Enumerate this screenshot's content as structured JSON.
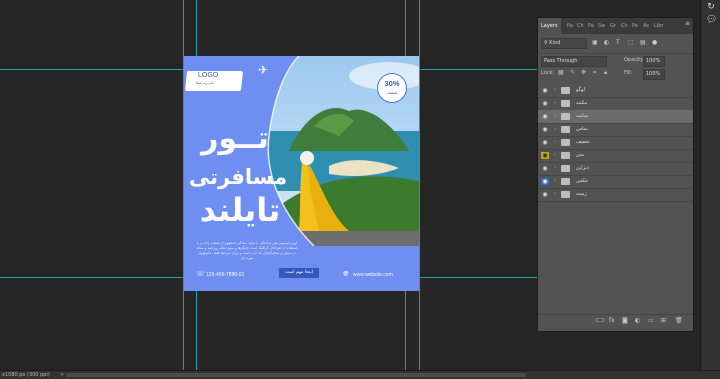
{
  "status": {
    "zoom": "x1080 px (300 ppi)",
    "arrow": ">"
  },
  "right_toolbar": {
    "icons": [
      "history-icon",
      "comments-icon"
    ]
  },
  "poster": {
    "logo": "LOGO",
    "logo_sub": "نام برند شما",
    "badge_percent": "30%",
    "badge_label": "تخفیف",
    "headline_1": "تــور",
    "headline_2": "مسافرتی",
    "headline_3": "تایلند",
    "paragraph": "لورم ایپسوم متن ساختگی با تولید سادگی نامفهوم از صنعت چاپ و با استفاده از طراحان گرافیک است چاپگرها و متون بلکه روزنامه و مجله در ستون و سطرآنچنان که لازم است و برای شرایط فعلی تکنولوژی مورد نیاز",
    "phone": "123-456-7890-01",
    "cta": "اینجا مهم است",
    "website": "www.website.com"
  },
  "layers_panel": {
    "tabs": [
      "Layers",
      "Pa",
      "Ch",
      "Pa",
      "Sw",
      "Gr",
      "Ch",
      "Pa",
      "Ac",
      "Libr"
    ],
    "active_tab": "Layers",
    "kind_label": "Kind",
    "blend_mode": "Pass Through",
    "opacity_label": "Opacity:",
    "opacity_value": "100%",
    "lock_label": "Lock:",
    "fill_label": "Fill:",
    "fill_value": "100%",
    "layers": [
      {
        "name": "لوگو",
        "visible": true,
        "selected": false,
        "eye_color": ""
      },
      {
        "name": "مکمه",
        "visible": true,
        "selected": false,
        "eye_color": ""
      },
      {
        "name": "سایت",
        "visible": true,
        "selected": true,
        "eye_color": ""
      },
      {
        "name": "تماس",
        "visible": true,
        "selected": false,
        "eye_color": ""
      },
      {
        "name": "تخفیف",
        "visible": true,
        "selected": false,
        "eye_color": ""
      },
      {
        "name": "متن",
        "visible": true,
        "selected": false,
        "eye_color": "#c5a21f"
      },
      {
        "name": "دیزاین",
        "visible": true,
        "selected": false,
        "eye_color": ""
      },
      {
        "name": "عکس",
        "visible": true,
        "selected": false,
        "eye_color": "#3a6bc2"
      },
      {
        "name": "زمینه",
        "visible": true,
        "selected": false,
        "eye_color": ""
      }
    ]
  }
}
